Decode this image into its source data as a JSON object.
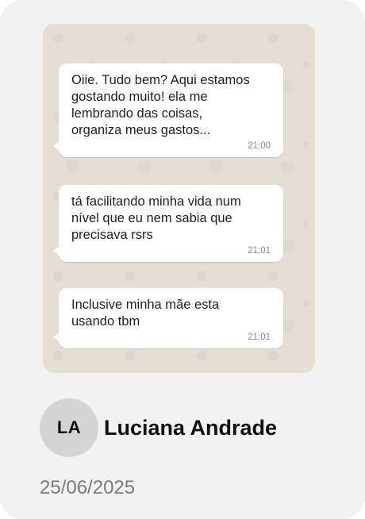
{
  "testimonial": {
    "messages": [
      {
        "text": "Oiie. Tudo bem? Aqui estamos\ngostando muito! ela me\nlembrando das coisas,\norganiza meus gastos...",
        "time": "21:00"
      },
      {
        "text": "tá facilitando minha vida num\nnível que eu nem sabia que\nprecisava rsrs",
        "time": "21:01"
      },
      {
        "text": "Inclusive minha mãe esta\nusando tbm",
        "time": "21:01"
      }
    ],
    "author": {
      "initials": "LA",
      "name": "Luciana Andrade"
    },
    "date": "25/06/2025"
  }
}
